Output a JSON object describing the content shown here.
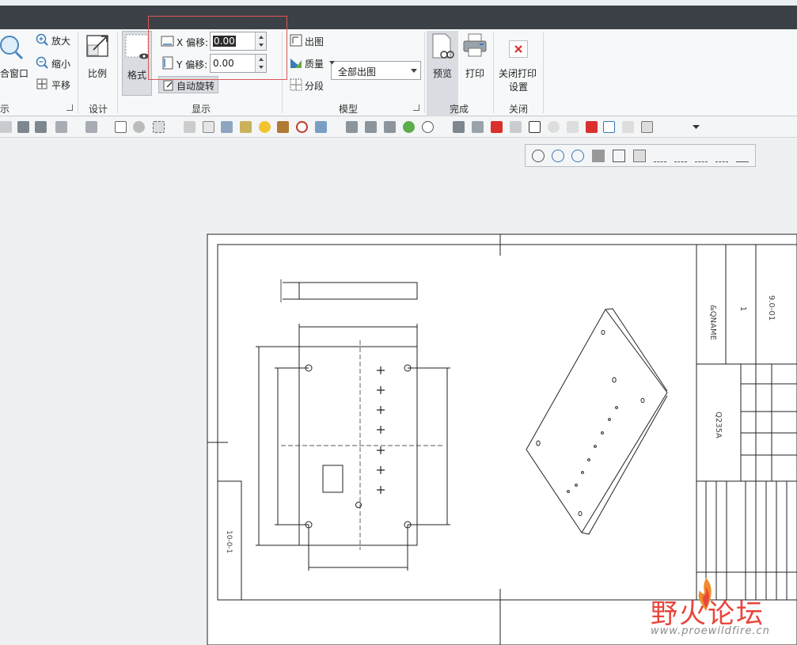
{
  "ribbon": {
    "group_partial": {
      "zoom_window_label": "合窗口",
      "zoom_in_label": "放大",
      "zoom_out_label": "缩小",
      "pan_label": "平移",
      "label": "示"
    },
    "design": {
      "scale_label": "比例",
      "label": "设计"
    },
    "display": {
      "format_label": "格式",
      "x_offset_label": "X 偏移:",
      "x_offset_value": "0.00",
      "y_offset_label": "Y 偏移:",
      "y_offset_value": "0.00",
      "auto_rotate_label": "自动旋转",
      "label": "显示"
    },
    "model": {
      "output_label": "出图",
      "output_option": "全部出图",
      "quality_label": "质量",
      "segment_label": "分段",
      "label": "模型"
    },
    "finish": {
      "preview_label": "预览",
      "print_label": "打印",
      "label": "完成"
    },
    "close": {
      "close_print_label_1": "关闭打印",
      "close_print_label_2": "设置",
      "label": "关闭"
    }
  },
  "drawing": {
    "title_block": {
      "name": "&QNAME",
      "number": "9.0-01",
      "material": "Q235A",
      "sheet": "1"
    },
    "stamp_vertical": "10-0-1"
  },
  "watermark": {
    "title": "野火论坛",
    "url": "www.proewildfire.cn"
  },
  "colors": {
    "titlebar": "#3b4146",
    "accent_red": "#e05555",
    "close_red": "#d9302c"
  }
}
